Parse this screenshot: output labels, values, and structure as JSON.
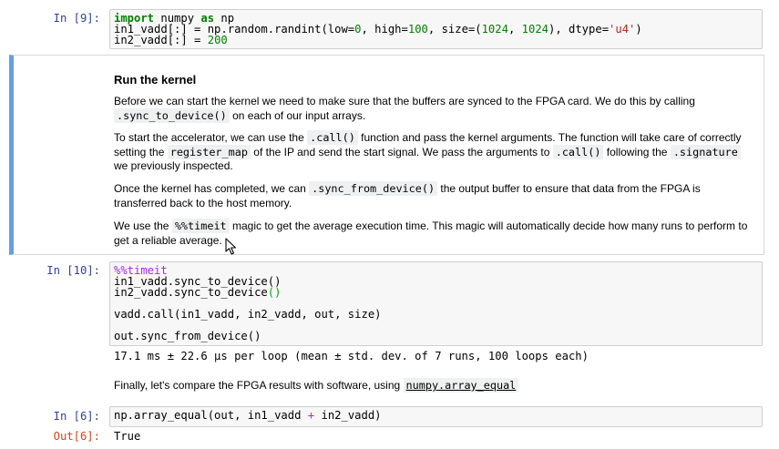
{
  "cells": {
    "c9": {
      "prompt": "In [9]:",
      "line1": {
        "kw1": "import",
        "mod": " numpy ",
        "kw2": "as",
        "alias": " np"
      },
      "line2": {
        "p1": "in1_vadd[:] = np.random.randint(low=",
        "n1": "0",
        "p2": ", high=",
        "n2": "100",
        "p3": ", size=(",
        "n3": "1024",
        "p4": ", ",
        "n4": "1024",
        "p5": "), dtype=",
        "s1": "'u4'",
        "p6": ")"
      },
      "line3": {
        "p1": "in2_vadd[:] = ",
        "n1": "200"
      }
    },
    "md": {
      "title": "Run the kernel",
      "para1_a": "Before we can start the kernel we need to make sure that the buffers are synced to the FPGA card. We do this by calling",
      "para1_code": ".sync_to_device()",
      "para1_b": " on each of our input arrays.",
      "para2_a": "To start the accelerator, we can use the ",
      "para2_code1": ".call()",
      "para2_b": " function and pass the kernel arguments. The function will take care of correctly",
      "para2_c": "setting the ",
      "para2_code2": "register_map",
      "para2_d": " of the IP and send the start signal. We pass the arguments to ",
      "para2_code3": ".call()",
      "para2_e": " following the ",
      "para2_code4": ".signature",
      "para2_f": "we previously inspected.",
      "para3_a": "Once the kernel has completed, we can ",
      "para3_code": ".sync_from_device()",
      "para3_b": " the output buffer to ensure that data from the FPGA is",
      "para3_c": "transferred back to the host memory.",
      "para4_a": "We use the ",
      "para4_code": "%%timeit",
      "para4_b": " magic to get the average execution time. This magic will automatically decide how many runs to perform to",
      "para4_c": "get a reliable average."
    },
    "c10": {
      "prompt": "In [10]:",
      "magic": "%%timeit",
      "line2": "in1_vadd.sync_to_device()",
      "line3a": "in2_vadd.sync_to_device",
      "line3b": "()",
      "line4": "vadd.call(in1_vadd, in2_vadd, out, size)",
      "line5": "out.sync_from_device()",
      "output": "17.1 ms ± 22.6 µs per loop (mean ± std. dev. of 7 runs, 100 loops each)"
    },
    "md2": {
      "text": "Finally, let's compare the FPGA results with software, using ",
      "link": "numpy.array_equal"
    },
    "c6": {
      "prompt": "In [6]:",
      "code_a": "np.array_equal(out, in1_vadd ",
      "op": "+",
      "code_b": " in2_vadd)",
      "out_prompt": "Out[6]:",
      "output": "True"
    }
  },
  "icons": {
    "cursor": "mouse-pointer-icon"
  },
  "colors": {
    "in_prompt": "#303f9f",
    "out_prompt": "#d84315",
    "selected_cell_bar": "#66a0dc"
  }
}
